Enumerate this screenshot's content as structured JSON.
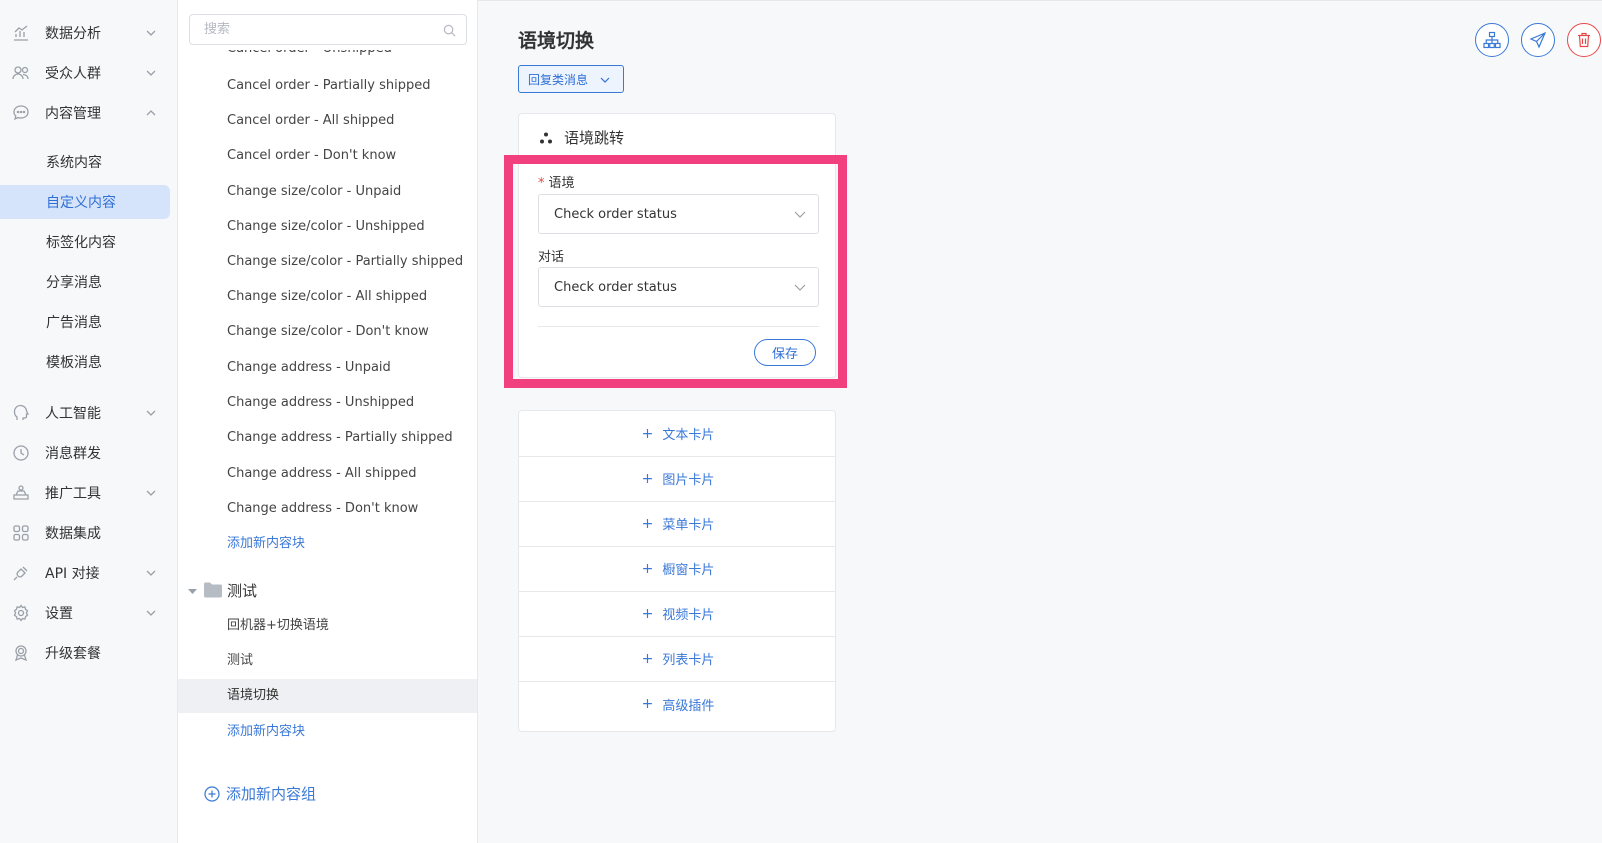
{
  "nav": {
    "items": [
      {
        "label": "数据分析",
        "icon": "chart-icon",
        "expandable": true,
        "expanded": false
      },
      {
        "label": "受众人群",
        "icon": "users-icon",
        "expandable": true,
        "expanded": false
      },
      {
        "label": "内容管理",
        "icon": "chat-bubble-icon",
        "expandable": true,
        "expanded": true
      },
      {
        "label": "人工智能",
        "icon": "head-icon",
        "expandable": true,
        "expanded": false
      },
      {
        "label": "消息群发",
        "icon": "clock-icon",
        "expandable": false
      },
      {
        "label": "推广工具",
        "icon": "promo-icon",
        "expandable": true,
        "expanded": false
      },
      {
        "label": "数据集成",
        "icon": "grid-icon",
        "expandable": false
      },
      {
        "label": "API 对接",
        "icon": "plug-icon",
        "expandable": true,
        "expanded": false
      },
      {
        "label": "设置",
        "icon": "gear-icon",
        "expandable": true,
        "expanded": false
      },
      {
        "label": "升级套餐",
        "icon": "badge-icon",
        "expandable": false
      }
    ],
    "content_sub": [
      {
        "label": "系统内容",
        "active": false
      },
      {
        "label": "自定义内容",
        "active": true
      },
      {
        "label": "标签化内容",
        "active": false
      },
      {
        "label": "分享消息",
        "active": false
      },
      {
        "label": "广告消息",
        "active": false
      },
      {
        "label": "模板消息",
        "active": false
      }
    ]
  },
  "list": {
    "search_placeholder": "搜索",
    "partial_item": "Cancel order - Unshipped",
    "items": [
      "Cancel order - Partially shipped",
      "Cancel order - All shipped",
      "Cancel order - Don't know",
      "Change size/color - Unpaid",
      "Change size/color - Unshipped",
      "Change size/color - Partially shipped",
      "Change size/color - All shipped",
      "Change size/color - Don't know",
      "Change address - Unpaid",
      "Change address - Unshipped",
      "Change address - Partially shipped",
      "Change address - All shipped",
      "Change address - Don't know"
    ],
    "add_block_label": "添加新内容块",
    "group": {
      "name": "测试",
      "items": [
        "回机器+切换语境",
        "测试",
        "语境切换"
      ],
      "selected_index": 2,
      "add_block_label": "添加新内容块"
    },
    "add_group_label": "添加新内容组"
  },
  "main": {
    "title": "语境切换",
    "reply_type_label": "回复类消息",
    "card": {
      "title": "语境跳转",
      "context_label": "语境",
      "context_value": "Check order status",
      "dialog_label": "对话",
      "dialog_value": "Check order status",
      "save_label": "保存"
    },
    "add_cards": [
      "文本卡片",
      "图片卡片",
      "菜单卡片",
      "橱窗卡片",
      "视频卡片",
      "列表卡片",
      "高级插件"
    ]
  },
  "colors": {
    "accent": "#3a78d8",
    "highlight": "#f2407e",
    "danger": "#e54848",
    "active_bg": "#d6e4fb"
  }
}
